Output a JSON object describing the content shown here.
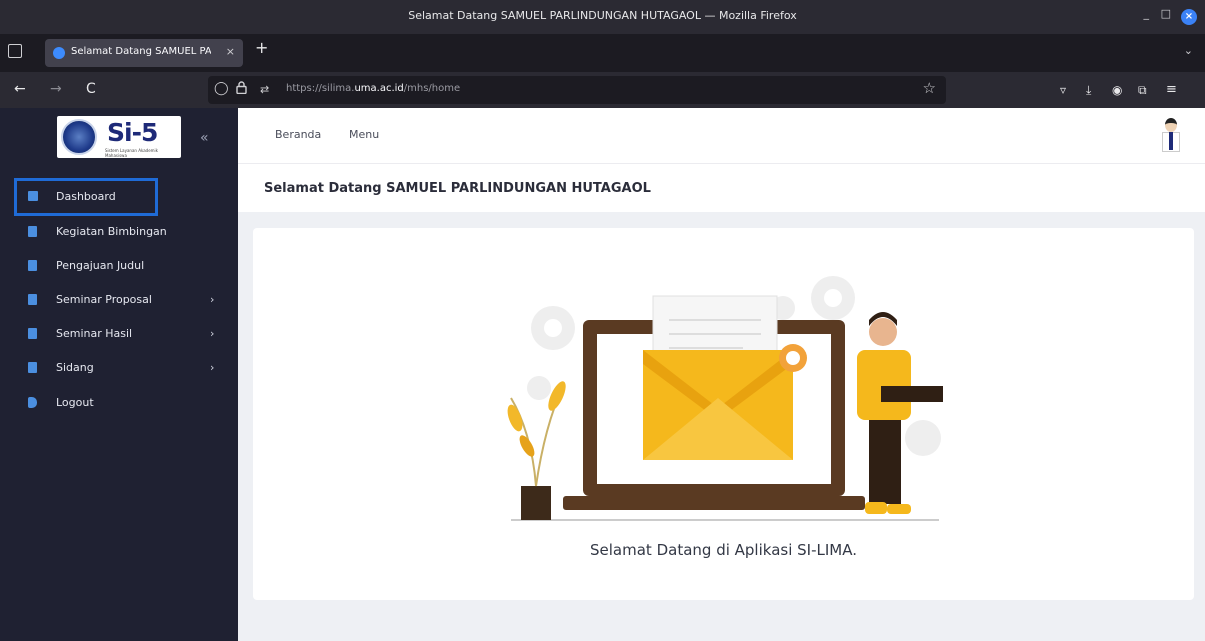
{
  "window": {
    "title": "Selamat Datang SAMUEL PARLINDUNGAN HUTAGAOL — Mozilla Firefox",
    "minimize": "_",
    "maximize": "□",
    "close": "×"
  },
  "tab": {
    "label": "Selamat Datang SAMUEL PA",
    "close": "×",
    "new_tab": "+"
  },
  "nav": {
    "back": "←",
    "forward": "→",
    "reload": "C",
    "url_prefix": "https://silima.",
    "url_domain": "uma.ac.id",
    "url_path": "/mhs/home",
    "bookmark": "☆"
  },
  "sidebar": {
    "logo_text": "Si-5",
    "logo_tagline": "Sistem Layanan Akademik Mahasiswa",
    "collapse": "«",
    "items": [
      {
        "label": "Dashboard",
        "has_submenu": false
      },
      {
        "label": "Kegiatan Bimbingan",
        "has_submenu": false
      },
      {
        "label": "Pengajuan Judul",
        "has_submenu": false
      },
      {
        "label": "Seminar Proposal",
        "has_submenu": true,
        "chevron": "›"
      },
      {
        "label": "Seminar Hasil",
        "has_submenu": true,
        "chevron": "›"
      },
      {
        "label": "Sidang",
        "has_submenu": true,
        "chevron": "›"
      },
      {
        "label": "Logout",
        "has_submenu": false
      }
    ]
  },
  "topbar": {
    "links": [
      "Beranda",
      "Menu"
    ]
  },
  "main": {
    "welcome_title": "Selamat Datang SAMUEL PARLINDUNGAN HUTAGAOL",
    "caption": "Selamat Datang di Aplikasi SI-LIMA."
  },
  "colors": {
    "sidebar_bg": "#1f2132",
    "accent_blue": "#1f6bd6",
    "illustration_yellow": "#f5b81c",
    "illustration_brown": "#5a3a22"
  }
}
